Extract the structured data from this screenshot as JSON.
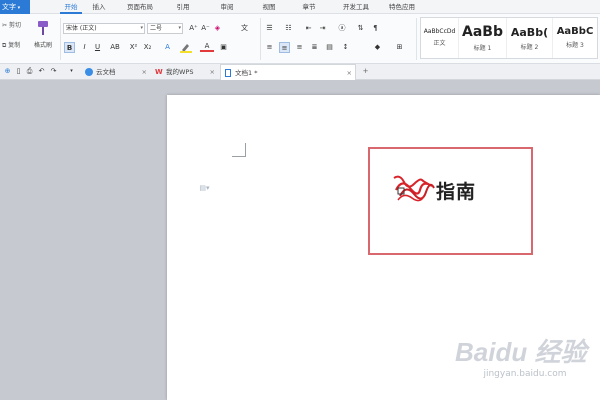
{
  "app": {
    "menu_label": "文字"
  },
  "ribbon_tabs": [
    "开始",
    "插入",
    "页面布局",
    "引用",
    "审阅",
    "视图",
    "章节",
    "开发工具",
    "特色应用"
  ],
  "ribbon": {
    "clipboard": {
      "cut_label": "剪切",
      "copy_label": "复制",
      "format_painter_label": "格式刷"
    },
    "font": {
      "family": "宋体 (正文)",
      "size": "二号"
    },
    "styles": [
      {
        "sample": "AaBbCcDd",
        "name": "正文"
      },
      {
        "sample": "AaBb",
        "name": "标题 1"
      },
      {
        "sample": "AaBb(",
        "name": "标题 2"
      },
      {
        "sample": "AaBbC",
        "name": "标题 3"
      }
    ]
  },
  "doc_tabs": [
    {
      "label": "云文档"
    },
    {
      "label": "我的WPS"
    },
    {
      "label": "文档1 *"
    }
  ],
  "document": {
    "heading": "指南"
  },
  "watermark": {
    "brand": "Baidu 经验",
    "url": "jingyan.baidu.com"
  },
  "colors": {
    "accent": "#2b7bd6",
    "highlight_box": "#d9686e",
    "wps_red": "#e0393e"
  }
}
